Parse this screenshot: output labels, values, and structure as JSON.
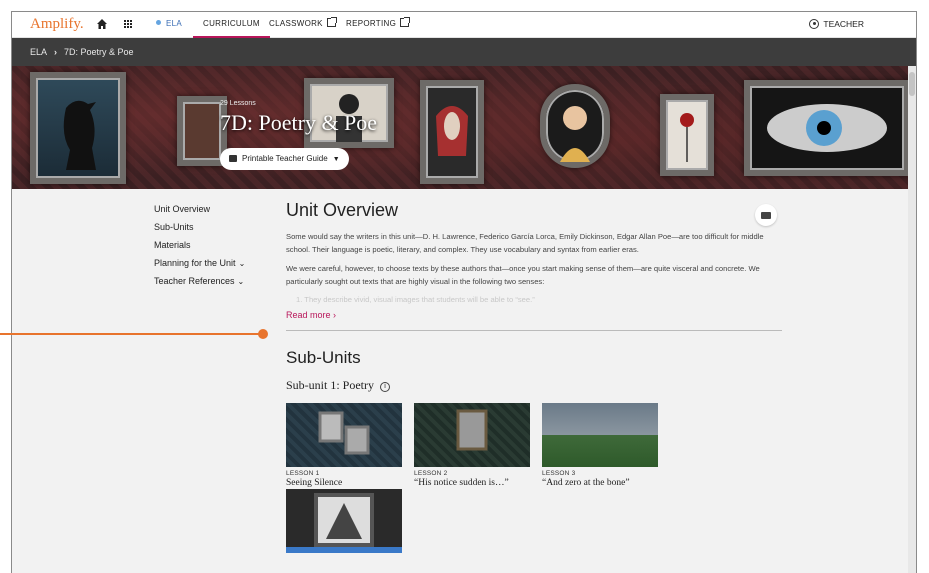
{
  "nav": {
    "logo": "Amplify.",
    "ela": "ELA",
    "curriculum": "CURRICULUM",
    "classwork": "CLASSWORK",
    "reporting": "REPORTING",
    "user": "TEACHER",
    "accent": "#b8165a",
    "brand": "#e8742d"
  },
  "breadcrumb": {
    "root": "ELA",
    "separator": "›",
    "current": "7D: Poetry & Poe"
  },
  "hero": {
    "lesson_count": "29 Lessons",
    "title": "7D: Poetry & Poe",
    "guide_button": "Printable Teacher Guide"
  },
  "subnav": {
    "items": [
      "Unit Overview",
      "Sub-Units",
      "Materials",
      "Planning for the Unit",
      "Teacher References"
    ]
  },
  "overview": {
    "heading": "Unit Overview",
    "para1": "Some would say the writers in this unit—D. H. Lawrence, Federico García Lorca, Emily Dickinson, Edgar Allan Poe—are too difficult for middle school. Their language is poetic, literary, and complex. They use vocabulary and syntax from earlier eras.",
    "para2": "We were careful, however, to choose texts by these authors that—once you start making sense of them—are quite visceral and concrete. We particularly sought out texts that are highly visual in the following two senses:",
    "faded": "1. They describe vivid, visual images that students will be able to “see.”",
    "read_more": "Read more"
  },
  "subunits": {
    "heading": "Sub-Units",
    "subunit1": "Sub-unit 1: Poetry",
    "lessons": [
      {
        "num": "LESSON 1",
        "title": "Seeing Silence"
      },
      {
        "num": "LESSON 2",
        "title": "“His notice sudden is…”"
      },
      {
        "num": "LESSON 3",
        "title": "“And zero at the bone”"
      }
    ]
  }
}
